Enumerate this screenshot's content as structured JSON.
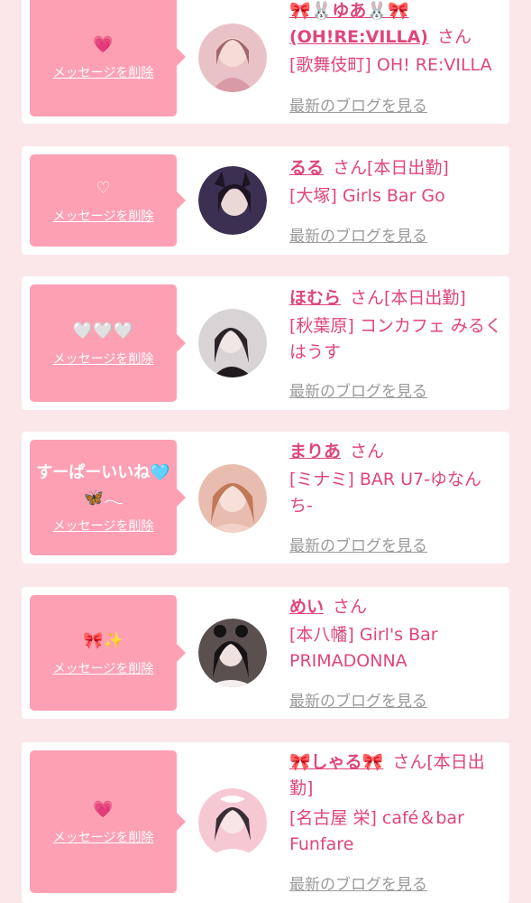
{
  "cards": [
    {
      "message": "💗",
      "delete_label": "メッセージを削除",
      "name": "🎀🐰ゆあ🐰🎀\n(OH!RE:VILLA)",
      "name_line1": "🎀🐰ゆあ🐰🎀",
      "name_line2": "(OH!RE:VILLA)",
      "san": "さん",
      "shop": "[歌舞伎町] OH! RE:VILLA",
      "blog_link": "最新のブログを見る",
      "avatar_icon": "profile-photo"
    },
    {
      "message": "♡",
      "delete_label": "メッセージを削除",
      "name": "るる",
      "san": "さん[本日出勤]",
      "shop": "[大塚] Girls Bar Go",
      "blog_link": "最新のブログを見る",
      "avatar_icon": "profile-photo"
    },
    {
      "message": "🤍🤍🤍",
      "delete_label": "メッセージを削除",
      "name": "ほむら",
      "san": "さん[本日出勤]",
      "shop": "[秋葉原] コンカフェ みるくはうす",
      "blog_link": "最新のブログを見る",
      "avatar_icon": "profile-photo"
    },
    {
      "message": "すーぱーいいね🩵🦋𓂃",
      "delete_label": "メッセージを削除",
      "name": "まりあ",
      "san": "さん",
      "shop": "[ミナミ] BAR U7-ゆなんち-",
      "blog_link": "最新のブログを見る",
      "avatar_icon": "profile-photo"
    },
    {
      "message": "🎀✨",
      "delete_label": "メッセージを削除",
      "name": "めい",
      "san": "さん",
      "shop": "[本八幡] Girl's Bar PRIMADONNA",
      "blog_link": "最新のブログを見る",
      "avatar_icon": "profile-photo"
    },
    {
      "message": "💗",
      "delete_label": "メッセージを削除",
      "name": "🎀しゃる🎀",
      "san": "さん[本日出勤]",
      "shop": "[名古屋 栄] café＆bar Funfare",
      "blog_link": "最新のブログを見る",
      "avatar_icon": "profile-photo"
    }
  ],
  "colors": {
    "background": "#fbe7ea",
    "bubble": "#fda0b4",
    "accent": "#e0457b",
    "link_gray": "#9a9a9a"
  }
}
